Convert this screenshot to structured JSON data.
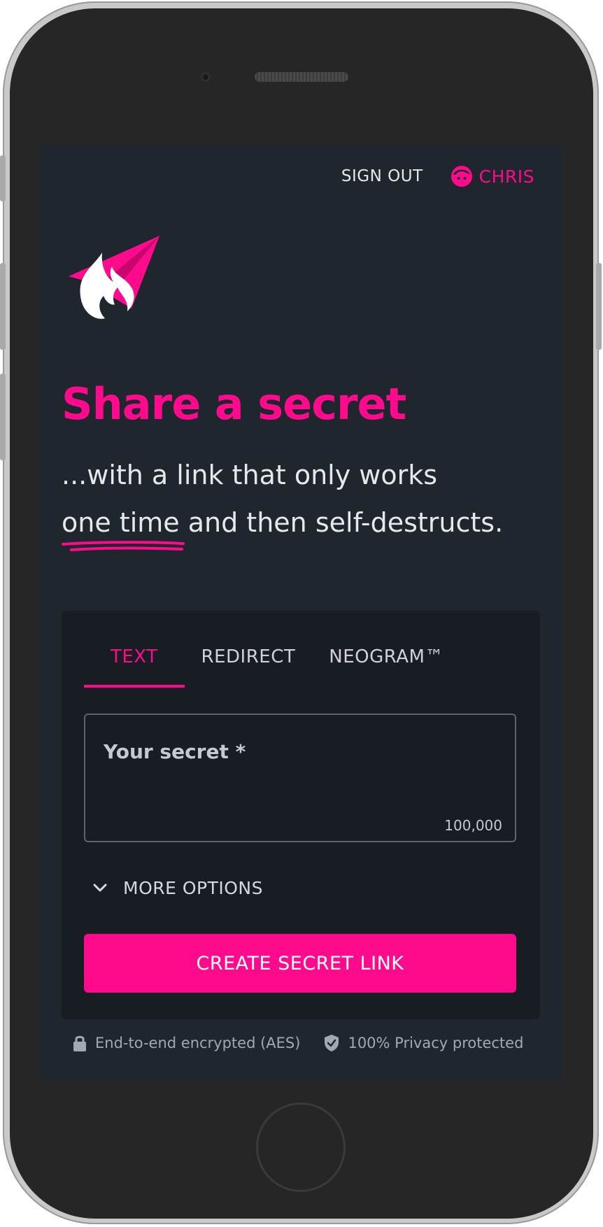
{
  "header": {
    "sign_out": "SIGN OUT",
    "username": "CHRIS",
    "user_icon": "face-icon"
  },
  "hero": {
    "title": "Share a secret",
    "subtitle_line1": "...with a link that only works",
    "subtitle_underlined": "one time",
    "subtitle_rest": " and then self-destructs."
  },
  "tabs": [
    {
      "label": "TEXT",
      "active": true
    },
    {
      "label": "REDIRECT",
      "active": false
    },
    {
      "label": "NEOGRAM™",
      "active": false
    }
  ],
  "form": {
    "secret_label": "Your secret *",
    "char_limit": "100,000",
    "more_options": "MORE OPTIONS",
    "submit": "CREATE SECRET LINK"
  },
  "footer": {
    "encrypted": "End-to-end encrypted (AES)",
    "privacy": "100% Privacy protected"
  },
  "colors": {
    "accent": "#ff0a8c",
    "background": "#1f262e",
    "card": "#181d23"
  }
}
